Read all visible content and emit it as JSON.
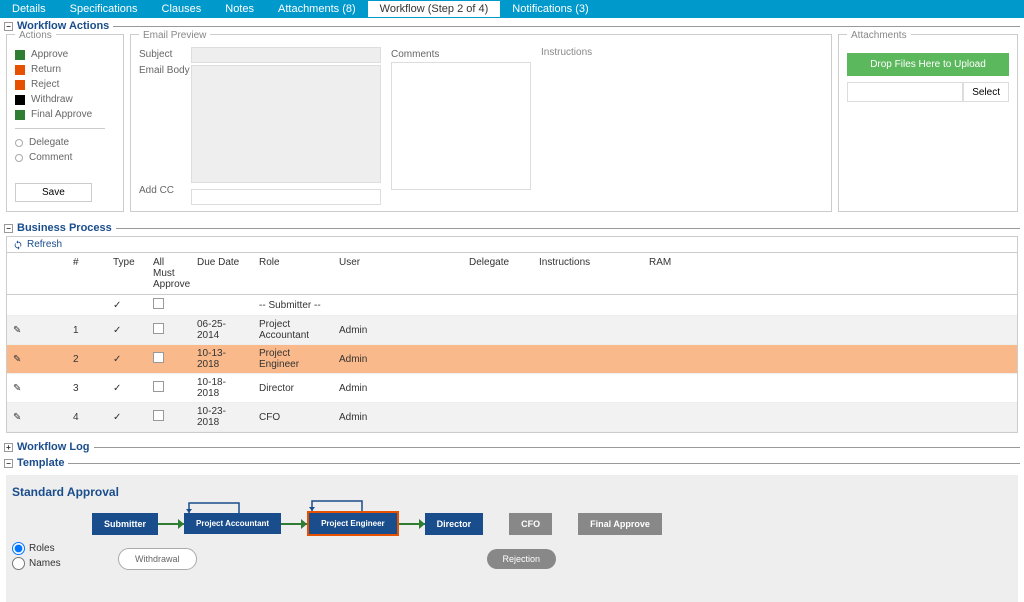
{
  "tabs": [
    {
      "label": "Details"
    },
    {
      "label": "Specifications"
    },
    {
      "label": "Clauses"
    },
    {
      "label": "Notes"
    },
    {
      "label": "Attachments (8)"
    },
    {
      "label": "Workflow (Step 2 of 4)"
    },
    {
      "label": "Notifications (3)"
    }
  ],
  "sections": {
    "actions": "Workflow Actions",
    "business": "Business Process",
    "log": "Workflow Log",
    "template": "Template"
  },
  "actions_list": [
    {
      "color": "green",
      "label": "Approve"
    },
    {
      "color": "orange",
      "label": "Return"
    },
    {
      "color": "orange",
      "label": "Reject"
    },
    {
      "color": "black",
      "label": "Withdraw"
    },
    {
      "color": "green",
      "label": "Final Approve"
    }
  ],
  "sub_actions": [
    "Delegate",
    "Comment"
  ],
  "save_label": "Save",
  "preview": {
    "title": "Email Preview",
    "subject_label": "Subject",
    "body_label": "Email Body",
    "cc_label": "Add CC",
    "comments_label": "Comments",
    "instructions_label": "Instructions"
  },
  "attachments": {
    "title": "Attachments",
    "drop_label": "Drop Files Here to Upload",
    "select_label": "Select"
  },
  "refresh_label": "Refresh",
  "grid_headers": [
    "",
    "#",
    "Type",
    "All Must Approve",
    "Due Date",
    "Role",
    "User",
    "Delegate",
    "Instructions",
    "RAM"
  ],
  "grid_rows": [
    {
      "num": "",
      "type_check": true,
      "must": false,
      "due": "",
      "role": "-- Submitter --",
      "user": "",
      "delegate": "",
      "instructions": "",
      "ram": "",
      "cls": "light",
      "edit": false,
      "must_show": true
    },
    {
      "num": "1",
      "type_check": true,
      "must": false,
      "due": "06-25-2014",
      "role": "Project Accountant",
      "user": "Admin",
      "delegate": "",
      "instructions": "",
      "ram": "",
      "cls": "shade",
      "edit": true,
      "must_show": true
    },
    {
      "num": "2",
      "type_check": true,
      "must": false,
      "due": "10-13-2018",
      "role": "Project Engineer",
      "user": "Admin",
      "delegate": "",
      "instructions": "",
      "ram": "",
      "cls": "highlight",
      "edit": true,
      "must_show": true
    },
    {
      "num": "3",
      "type_check": true,
      "must": false,
      "due": "10-18-2018",
      "role": "Director",
      "user": "Admin",
      "delegate": "",
      "instructions": "",
      "ram": "",
      "cls": "light",
      "edit": true,
      "must_show": true
    },
    {
      "num": "4",
      "type_check": true,
      "must": false,
      "due": "10-23-2018",
      "role": "CFO",
      "user": "Admin",
      "delegate": "",
      "instructions": "",
      "ram": "",
      "cls": "shade",
      "edit": true,
      "must_show": true
    }
  ],
  "template": {
    "title": "Standard Approval",
    "radio_roles": "Roles",
    "radio_names": "Names",
    "nodes": {
      "submitter": "Submitter",
      "pa": "Project Accountant",
      "pe": "Project Engineer",
      "director": "Director",
      "cfo": "CFO",
      "fa": "Final Approve",
      "withdrawal": "Withdrawal",
      "rejection": "Rejection"
    }
  }
}
